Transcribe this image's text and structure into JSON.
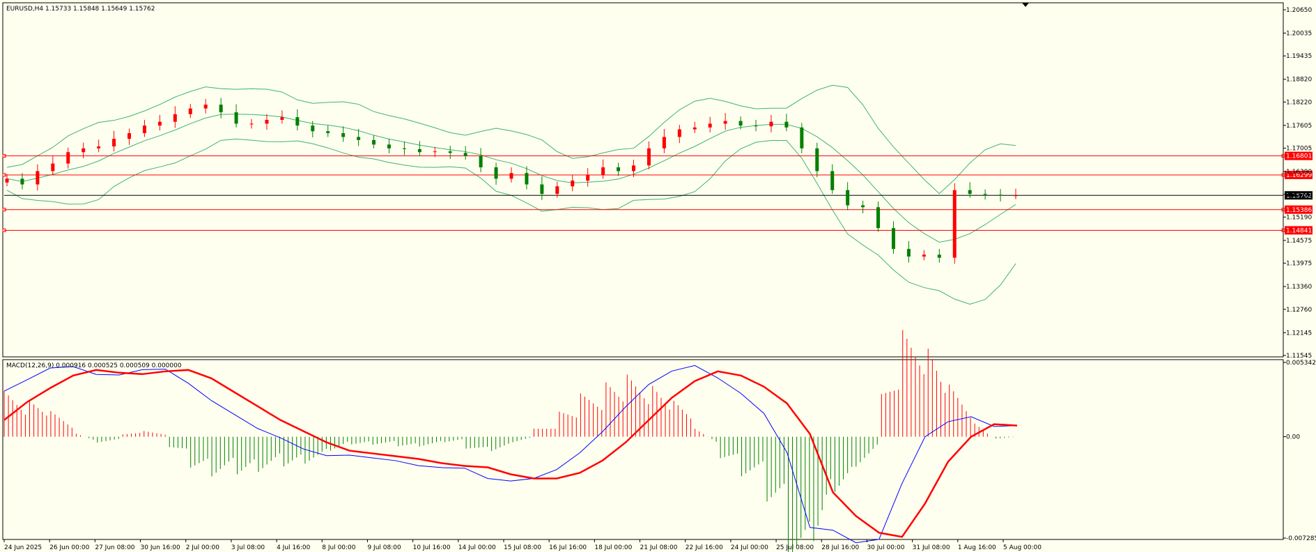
{
  "main_panel": {
    "header": "EURUSD,H4  1.15733 1.15848 1.15649 1.15762"
  },
  "macd_panel": {
    "header": "MACD(12,26,9) 0.000916 0.000525 0.000509 0.000000"
  },
  "colors": {
    "background": "#FFFFF0",
    "grid_border": "#000000",
    "bull_candle": "#FF0000",
    "bear_candle": "#008000",
    "bollinger": "#3CB371",
    "hline_red": "#FF0000",
    "hline_current": "#000000",
    "macd_signal": "#FF0000",
    "macd_line": "#0000FF",
    "hist_pos": "#FF0000",
    "hist_neg": "#008000"
  },
  "chart_data": [
    {
      "type": "candlestick",
      "symbol": "EURUSD",
      "timeframe": "H4",
      "ohlc_last": {
        "open": 1.15733,
        "high": 1.15848,
        "low": 1.15649,
        "close": 1.15762
      },
      "ylim": [
        1.11545,
        1.2065
      ],
      "y_ticks": [
        "1.20650",
        "1.20035",
        "1.19435",
        "1.18820",
        "1.18220",
        "1.17605",
        "1.17005",
        "1.16390",
        "1.15790",
        "1.15190",
        "1.14575",
        "1.13975",
        "1.13360",
        "1.12760",
        "1.12145",
        "1.11545"
      ],
      "x_ticks": [
        "24 Jun 2025",
        "26 Jun 00:00",
        "27 Jun 08:00",
        "30 Jun 16:00",
        "2 Jul 00:00",
        "3 Jul 08:00",
        "4 Jul 16:00",
        "8 Jul 00:00",
        "9 Jul 08:00",
        "10 Jul 16:00",
        "14 Jul 00:00",
        "15 Jul 08:00",
        "16 Jul 16:00",
        "18 Jul 00:00",
        "21 Jul 08:00",
        "22 Jul 16:00",
        "24 Jul 00:00",
        "25 Jul 08:00",
        "28 Jul 16:00",
        "30 Jul 00:00",
        "31 Jul 08:00",
        "1 Aug 16:00",
        "5 Aug 00:00"
      ],
      "close_path": [
        1.162,
        1.1605,
        1.164,
        1.166,
        1.169,
        1.17,
        1.1705,
        1.1725,
        1.174,
        1.176,
        1.177,
        1.179,
        1.1805,
        1.1815,
        1.1795,
        1.1765,
        1.1765,
        1.1775,
        1.1782,
        1.176,
        1.1745,
        1.174,
        1.173,
        1.1722,
        1.171,
        1.17,
        1.1698,
        1.169,
        1.1692,
        1.1688,
        1.168,
        1.165,
        1.162,
        1.1635,
        1.1605,
        1.158,
        1.16,
        1.1615,
        1.163,
        1.165,
        1.164,
        1.1655,
        1.17,
        1.173,
        1.175,
        1.1755,
        1.1765,
        1.1772,
        1.176,
        1.1758,
        1.177,
        1.1755,
        1.17,
        1.164,
        1.159,
        1.155,
        1.1545,
        1.149,
        1.1435,
        1.1415,
        1.142,
        1.1412,
        1.159,
        1.158,
        1.1578,
        1.1576,
        1.1576
      ],
      "horizontal_levels": [
        {
          "label": "1.16801",
          "value": 1.16801,
          "color": "red"
        },
        {
          "label": "1.16299",
          "value": 1.16299,
          "color": "red"
        },
        {
          "label": "1.15762",
          "value": 1.15762,
          "color": "black"
        },
        {
          "label": "1.15386",
          "value": 1.15386,
          "color": "red"
        },
        {
          "label": "1.14841",
          "value": 1.14841,
          "color": "red"
        }
      ],
      "indicators": [
        "Bollinger Bands"
      ]
    },
    {
      "type": "line",
      "name": "MACD(12,26,9)",
      "values_header": [
        0.000916,
        0.000525,
        0.000509,
        0.0
      ],
      "ylim": [
        -0.007285,
        0.005342
      ],
      "y_ticks": [
        "0.005342",
        "0.00",
        "-0.007285"
      ],
      "signal_path": [
        0.0012,
        0.0025,
        0.0035,
        0.0044,
        0.0048,
        0.0046,
        0.0045,
        0.0047,
        0.0048,
        0.0042,
        0.0032,
        0.0022,
        0.0012,
        0.0004,
        -0.0004,
        -0.001,
        -0.0012,
        -0.0014,
        -0.0016,
        -0.0019,
        -0.0021,
        -0.0022,
        -0.0027,
        -0.003,
        -0.003,
        -0.0026,
        -0.0017,
        -0.0004,
        0.0012,
        0.0028,
        0.004,
        0.0047,
        0.0044,
        0.0036,
        0.0024,
        0.0002,
        -0.004,
        -0.0057,
        -0.0069,
        -0.0072,
        -0.0048,
        -0.0018,
        0.0,
        0.0009,
        0.0008
      ]
    }
  ]
}
